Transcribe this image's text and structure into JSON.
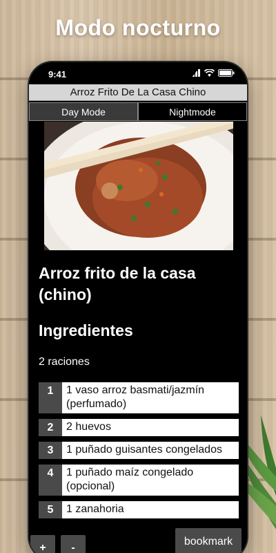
{
  "promo": {
    "title": "Modo nocturno"
  },
  "status_bar": {
    "time": "9:41"
  },
  "app": {
    "title": "Arroz Frito De La Casa Chino",
    "tabs": [
      {
        "label": "Day Mode",
        "active": false
      },
      {
        "label": "Nightmode",
        "active": true
      }
    ]
  },
  "recipe": {
    "title": "Arroz frito de la casa (chino)",
    "section_title": "Ingredientes",
    "servings": "2 raciones",
    "ingredients": [
      {
        "num": "1",
        "text": "1 vaso arroz basmati/jazmín (perfumado)"
      },
      {
        "num": "2",
        "text": "2 huevos"
      },
      {
        "num": "3",
        "text": "1 puñado guisantes congelados"
      },
      {
        "num": "4",
        "text": "1 puñado maíz congelado (opcional)"
      },
      {
        "num": "5",
        "text": "1 zanahoria"
      }
    ]
  },
  "controls": {
    "plus": "+",
    "minus": "-",
    "bookmark": "bookmark"
  },
  "colors": {
    "night_bg": "#000000",
    "button_gray": "#4a4a4a",
    "title_bar": "#d6d6d6"
  }
}
